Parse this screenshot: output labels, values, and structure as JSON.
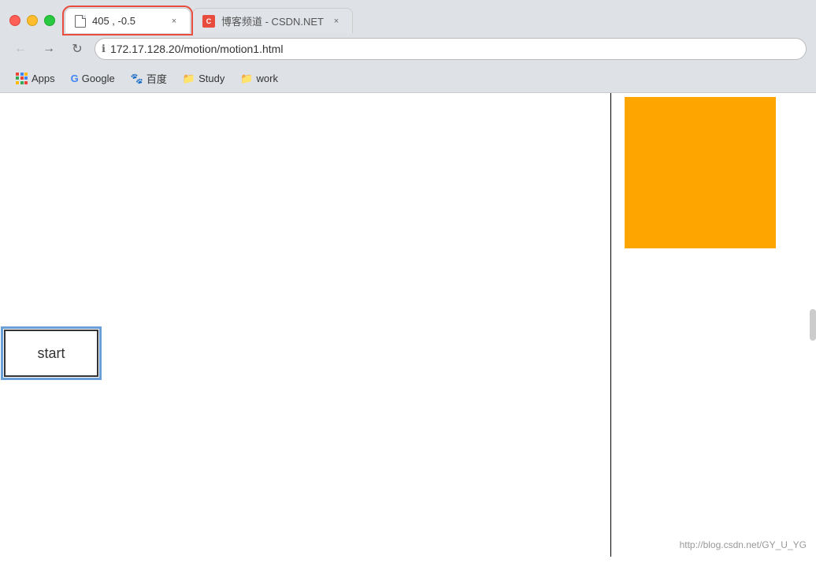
{
  "browser": {
    "traffic_lights": [
      "red",
      "yellow",
      "green"
    ],
    "tabs": [
      {
        "id": "tab-active",
        "title": "405 , -0.5",
        "favicon_type": "page",
        "active": true,
        "close_label": "×"
      },
      {
        "id": "tab-csdn",
        "title": "博客频道 - CSDN.NET",
        "favicon_type": "csdn",
        "active": false,
        "close_label": "×"
      }
    ],
    "nav": {
      "back_label": "←",
      "forward_label": "→",
      "refresh_label": "↻"
    },
    "address_bar": {
      "info_icon": "ℹ",
      "url": "172.17.128.20/motion/motion1.html"
    },
    "bookmarks": [
      {
        "id": "apps",
        "label": "Apps",
        "icon_type": "grid"
      },
      {
        "id": "google",
        "label": "Google",
        "icon_type": "google"
      },
      {
        "id": "baidu",
        "label": "百度",
        "icon_type": "baidu"
      },
      {
        "id": "study",
        "label": "Study",
        "icon_type": "folder"
      },
      {
        "id": "work",
        "label": "work",
        "icon_type": "folder"
      }
    ]
  },
  "page": {
    "start_button_label": "start",
    "status_text": "http://blog.csdn.net/GY_U_YG",
    "orange_box_color": "#FFA500",
    "divider_color": "#000000"
  }
}
